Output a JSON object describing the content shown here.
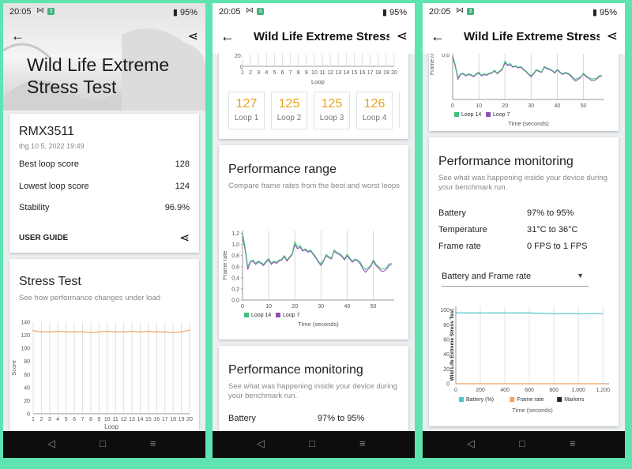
{
  "status": {
    "time": "20:05",
    "badge": "3",
    "battery": "95%"
  },
  "panel1": {
    "hero_title_line1": "Wild Life Extreme",
    "hero_title_line2": "Stress Test",
    "device": "RMX3511",
    "date": "thg 10 5, 2022 19:49",
    "stats": [
      {
        "label": "Best loop score",
        "value": "128"
      },
      {
        "label": "Lowest loop score",
        "value": "124"
      },
      {
        "label": "Stability",
        "value": "96.9%"
      }
    ],
    "user_guide": "USER GUIDE",
    "stress_title": "Stress Test",
    "stress_sub": "See how performance changes under load"
  },
  "panel2": {
    "title": "Wild Life Extreme Stress...",
    "loops": [
      {
        "score": "127",
        "label": "Loop 1"
      },
      {
        "score": "125",
        "label": "Loop 2"
      },
      {
        "score": "125",
        "label": "Loop 3"
      },
      {
        "score": "126",
        "label": "Loop 4"
      }
    ],
    "range_title": "Performance range",
    "range_sub": "Compare frame rates from the best and worst loops",
    "monitor_title": "Performance monitoring",
    "monitor_sub": "See what was happening inside your device during your benchmark run.",
    "battery_label": "Battery",
    "battery_value": "97% to 95%"
  },
  "panel3": {
    "title": "Wild Life Extreme Stress...",
    "monitor_title": "Performance monitoring",
    "monitor_sub": "See what was happening inside your device during your benchmark run.",
    "rows": [
      {
        "label": "Battery",
        "value": "97% to 95%"
      },
      {
        "label": "Temperature",
        "value": "31°C to 36°C"
      },
      {
        "label": "Frame rate",
        "value": "0 FPS to 1 FPS"
      }
    ],
    "dropdown": "Battery and Frame rate"
  },
  "chart_data": [
    {
      "type": "line",
      "title": "Stress Test",
      "xlabel": "Loop",
      "ylabel": "Score",
      "x": [
        1,
        2,
        3,
        4,
        5,
        6,
        7,
        8,
        9,
        10,
        11,
        12,
        13,
        14,
        15,
        16,
        17,
        18,
        19,
        20
      ],
      "y": [
        127,
        125,
        125,
        126,
        125,
        125,
        125,
        124,
        125,
        126,
        125,
        125,
        126,
        125,
        126,
        125,
        125,
        124,
        125,
        128
      ],
      "yticks": [
        0,
        20,
        40,
        60,
        80,
        100,
        120,
        140
      ],
      "ylim": [
        0,
        140
      ],
      "color": "#f3a460"
    },
    {
      "type": "line",
      "title": "Performance range",
      "xlabel": "Time (seconds)",
      "ylabel": "Frame rate",
      "yticks": [
        "0,0",
        "0,2",
        "0,4",
        "0,6",
        "0,8",
        "1,0",
        "1,2"
      ],
      "xticks": [
        0,
        10,
        20,
        30,
        40,
        50
      ],
      "xlim": [
        0,
        58
      ],
      "ylim": [
        0,
        1.25
      ],
      "series": [
        {
          "name": "Loop 14",
          "color": "#3fc07a",
          "x": [
            0,
            1,
            2,
            3,
            4,
            5,
            6,
            7,
            8,
            9,
            10,
            11,
            12,
            13,
            14,
            15,
            16,
            17,
            18,
            19,
            20,
            21,
            22,
            23,
            24,
            25,
            26,
            27,
            28,
            29,
            30,
            31,
            32,
            33,
            34,
            35,
            36,
            37,
            38,
            39,
            40,
            41,
            42,
            43,
            44,
            45,
            46,
            47,
            48,
            49,
            50,
            51,
            52,
            53,
            54,
            55,
            56,
            57
          ],
          "y": [
            1.2,
            0.95,
            0.6,
            0.7,
            0.72,
            0.66,
            0.7,
            0.68,
            0.64,
            0.7,
            0.75,
            0.66,
            0.7,
            0.68,
            0.72,
            0.74,
            0.8,
            0.72,
            0.78,
            0.84,
            1.05,
            0.95,
            0.98,
            0.9,
            0.92,
            0.88,
            0.9,
            0.84,
            0.78,
            0.7,
            0.65,
            0.72,
            0.82,
            0.78,
            0.76,
            0.9,
            0.86,
            0.84,
            0.8,
            0.74,
            0.82,
            0.76,
            0.7,
            0.74,
            0.72,
            0.68,
            0.6,
            0.55,
            0.58,
            0.62,
            0.72,
            0.65,
            0.6,
            0.56,
            0.56,
            0.58,
            0.65,
            0.66
          ]
        },
        {
          "name": "Loop 7",
          "color": "#8e4fb0",
          "x": [
            0,
            1,
            2,
            3,
            4,
            5,
            6,
            7,
            8,
            9,
            10,
            11,
            12,
            13,
            14,
            15,
            16,
            17,
            18,
            19,
            20,
            21,
            22,
            23,
            24,
            25,
            26,
            27,
            28,
            29,
            30,
            31,
            32,
            33,
            34,
            35,
            36,
            37,
            38,
            39,
            40,
            41,
            42,
            43,
            44,
            45,
            46,
            47,
            48,
            49,
            50,
            51,
            52,
            53,
            54,
            55,
            56,
            57
          ],
          "y": [
            1.15,
            0.9,
            0.55,
            0.68,
            0.7,
            0.64,
            0.68,
            0.66,
            0.62,
            0.68,
            0.72,
            0.64,
            0.68,
            0.66,
            0.7,
            0.72,
            0.78,
            0.7,
            0.76,
            0.82,
            1.0,
            0.92,
            0.95,
            0.88,
            0.9,
            0.86,
            0.88,
            0.82,
            0.76,
            0.68,
            0.62,
            0.7,
            0.8,
            0.76,
            0.74,
            0.88,
            0.84,
            0.82,
            0.78,
            0.72,
            0.8,
            0.74,
            0.68,
            0.72,
            0.7,
            0.65,
            0.56,
            0.5,
            0.55,
            0.6,
            0.7,
            0.62,
            0.58,
            0.52,
            0.52,
            0.55,
            0.62,
            0.64
          ]
        }
      ]
    },
    {
      "type": "line",
      "title": "Wild Life Extreme Stress Test",
      "xlabel": "Time (seconds)",
      "yticks": [
        0,
        20,
        40,
        60,
        80,
        100
      ],
      "xticks": [
        "0",
        "200",
        "400",
        "600",
        "800",
        "1.000",
        "1.200"
      ],
      "xlim": [
        0,
        1250
      ],
      "ylim": [
        0,
        105
      ],
      "series": [
        {
          "name": "Battery (%)",
          "color": "#4fc3c8",
          "x": [
            0,
            20,
            200,
            400,
            600,
            800,
            1000,
            1200
          ],
          "y": [
            97,
            96,
            96,
            96,
            96,
            95,
            95,
            95
          ]
        },
        {
          "name": "Frame rate",
          "color": "#f3a460",
          "x": [
            0,
            200,
            400,
            600,
            800,
            1000,
            1200
          ],
          "y": [
            0,
            0,
            0,
            0,
            0,
            0,
            0
          ]
        },
        {
          "name": "Markers",
          "color": "#222222",
          "x": [],
          "y": []
        }
      ]
    }
  ]
}
